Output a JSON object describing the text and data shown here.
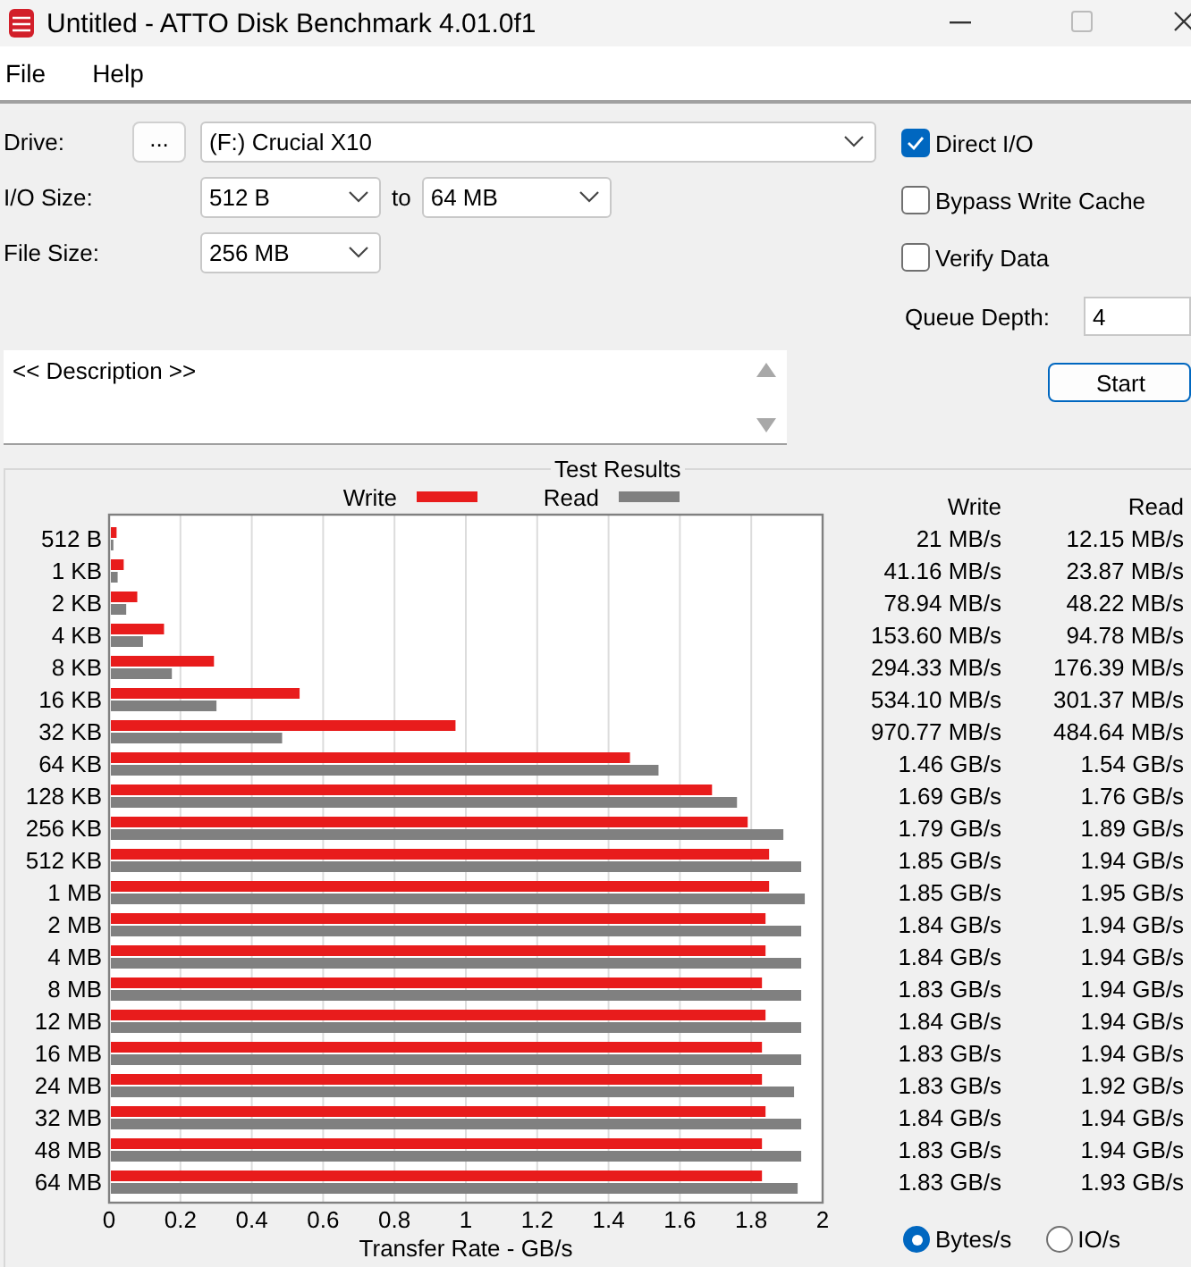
{
  "window": {
    "title": "Untitled - ATTO Disk Benchmark 4.01.0f1"
  },
  "menu": [
    "File",
    "Help"
  ],
  "settings": {
    "drive": {
      "label": "Drive:",
      "browse": "...",
      "value": "(F:) Crucial X10"
    },
    "io_size": {
      "label": "I/O Size:",
      "from": "512 B",
      "to_label": "to",
      "to": "64 MB"
    },
    "file_size": {
      "label": "File Size:",
      "value": "256 MB"
    }
  },
  "options": [
    {
      "label": "Direct I/O",
      "checked": true
    },
    {
      "label": "Bypass Write Cache",
      "checked": false
    },
    {
      "label": "Verify Data",
      "checked": false
    }
  ],
  "queue_depth": {
    "label": "Queue Depth:",
    "value": "4"
  },
  "start_button": "Start",
  "description": {
    "value": "<< Description >>"
  },
  "results": {
    "title": "Test Results",
    "chart_data": {
      "type": "bar",
      "orientation": "horizontal",
      "xlabel": "Transfer Rate - GB/s",
      "categories": [
        "512 B",
        "1 KB",
        "2 KB",
        "4 KB",
        "8 KB",
        "16 KB",
        "32 KB",
        "64 KB",
        "128 KB",
        "256 KB",
        "512 KB",
        "1 MB",
        "2 MB",
        "4 MB",
        "8 MB",
        "12 MB",
        "16 MB",
        "24 MB",
        "32 MB",
        "48 MB",
        "64 MB"
      ],
      "series": [
        {
          "name": "Write",
          "color": "#e81c1c",
          "values": [
            0.021,
            0.041,
            0.079,
            0.154,
            0.294,
            0.534,
            0.971,
            1.46,
            1.69,
            1.79,
            1.85,
            1.85,
            1.84,
            1.84,
            1.83,
            1.84,
            1.83,
            1.83,
            1.84,
            1.83,
            1.83
          ]
        },
        {
          "name": "Read",
          "color": "#808080",
          "values": [
            0.012,
            0.024,
            0.048,
            0.095,
            0.176,
            0.301,
            0.485,
            1.54,
            1.76,
            1.89,
            1.94,
            1.95,
            1.94,
            1.94,
            1.94,
            1.94,
            1.94,
            1.92,
            1.94,
            1.94,
            1.93
          ]
        }
      ],
      "grid": true,
      "legend": true,
      "xlim": [
        0,
        2
      ],
      "xticks": [
        0,
        0.2,
        0.4,
        0.6,
        0.8,
        1,
        1.2,
        1.4,
        1.6,
        1.8,
        2
      ]
    },
    "columns": [
      "Write",
      "Read"
    ],
    "rows": [
      {
        "write": "21 MB/s",
        "read": "12.15 MB/s"
      },
      {
        "write": "41.16 MB/s",
        "read": "23.87 MB/s"
      },
      {
        "write": "78.94 MB/s",
        "read": "48.22 MB/s"
      },
      {
        "write": "153.60 MB/s",
        "read": "94.78 MB/s"
      },
      {
        "write": "294.33 MB/s",
        "read": "176.39 MB/s"
      },
      {
        "write": "534.10 MB/s",
        "read": "301.37 MB/s"
      },
      {
        "write": "970.77 MB/s",
        "read": "484.64 MB/s"
      },
      {
        "write": "1.46 GB/s",
        "read": "1.54 GB/s"
      },
      {
        "write": "1.69 GB/s",
        "read": "1.76 GB/s"
      },
      {
        "write": "1.79 GB/s",
        "read": "1.89 GB/s"
      },
      {
        "write": "1.85 GB/s",
        "read": "1.94 GB/s"
      },
      {
        "write": "1.85 GB/s",
        "read": "1.95 GB/s"
      },
      {
        "write": "1.84 GB/s",
        "read": "1.94 GB/s"
      },
      {
        "write": "1.84 GB/s",
        "read": "1.94 GB/s"
      },
      {
        "write": "1.83 GB/s",
        "read": "1.94 GB/s"
      },
      {
        "write": "1.84 GB/s",
        "read": "1.94 GB/s"
      },
      {
        "write": "1.83 GB/s",
        "read": "1.94 GB/s"
      },
      {
        "write": "1.83 GB/s",
        "read": "1.92 GB/s"
      },
      {
        "write": "1.84 GB/s",
        "read": "1.94 GB/s"
      },
      {
        "write": "1.83 GB/s",
        "read": "1.94 GB/s"
      },
      {
        "write": "1.83 GB/s",
        "read": "1.93 GB/s"
      }
    ],
    "units": [
      {
        "label": "Bytes/s",
        "selected": true
      },
      {
        "label": "IO/s",
        "selected": false
      }
    ]
  }
}
